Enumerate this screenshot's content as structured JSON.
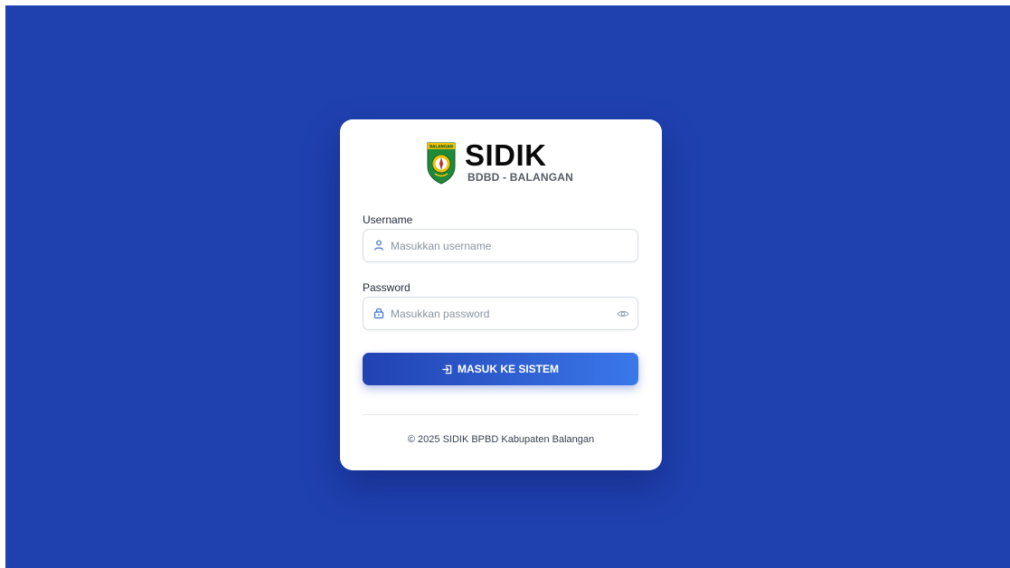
{
  "brand": {
    "title": "SIDIK",
    "subtitle": "BDBD - BALANGAN",
    "emblem_text": "BALANGAN",
    "colors": {
      "background": "#1f40af",
      "emblem_green": "#1e8a3a",
      "emblem_yellow": "#f2c200"
    }
  },
  "form": {
    "username": {
      "label": "Username",
      "value": "",
      "placeholder": "Masukkan username",
      "icon": "user-icon"
    },
    "password": {
      "label": "Password",
      "value": "",
      "placeholder": "Masukkan password",
      "icon": "lock-icon",
      "toggle_icon": "eye-icon"
    },
    "submit": {
      "label": "MASUK KE SISTEM",
      "icon": "login-icon",
      "gradient_start": "#2242b2",
      "gradient_end": "#3a78ea"
    }
  },
  "footer": {
    "text": "© 2025 SIDIK BPBD Kabupaten Balangan"
  }
}
